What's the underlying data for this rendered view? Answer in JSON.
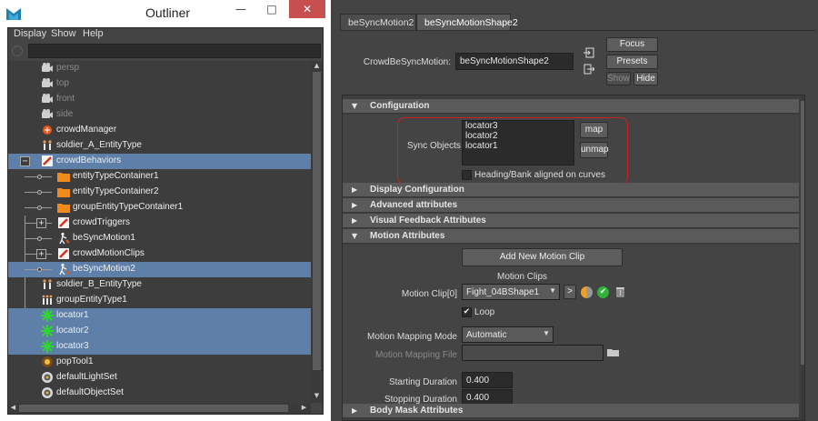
{
  "outliner": {
    "title": "Outliner",
    "window_buttons": {
      "minimize": "—",
      "maximize": "□",
      "close": "✕"
    },
    "menu": [
      "Display",
      "Show",
      "Help"
    ],
    "items": [
      {
        "label": "persp",
        "icon": "camera-icon",
        "dim": true,
        "selected": false
      },
      {
        "label": "top",
        "icon": "camera-icon",
        "dim": true,
        "selected": false
      },
      {
        "label": "front",
        "icon": "camera-icon",
        "dim": true,
        "selected": false
      },
      {
        "label": "side",
        "icon": "camera-icon",
        "dim": true,
        "selected": false
      },
      {
        "label": "crowdManager",
        "icon": "crowd-manager-icon",
        "dim": false,
        "selected": false
      },
      {
        "label": "soldier_A_EntityType",
        "icon": "entity-type-icon",
        "dim": false,
        "selected": false
      },
      {
        "label": "crowdBehaviors",
        "icon": "behavior-icon",
        "dim": false,
        "selected": true,
        "expander": "−"
      },
      {
        "label": "entityTypeContainer1",
        "icon": "folder-icon",
        "dim": false,
        "selected": false
      },
      {
        "label": "entityTypeContainer2",
        "icon": "folder-icon",
        "dim": false,
        "selected": false
      },
      {
        "label": "groupEntityTypeContainer1",
        "icon": "folder-icon",
        "dim": false,
        "selected": false
      },
      {
        "label": "crowdTriggers",
        "icon": "behavior-icon",
        "dim": false,
        "selected": false,
        "expander": "+"
      },
      {
        "label": "beSyncMotion1",
        "icon": "sync-motion-icon",
        "dim": false,
        "selected": false
      },
      {
        "label": "crowdMotionClips",
        "icon": "behavior-icon",
        "dim": false,
        "selected": false,
        "expander": "+"
      },
      {
        "label": "beSyncMotion2",
        "icon": "sync-motion-icon",
        "dim": false,
        "selected": true
      },
      {
        "label": "soldier_B_EntityType",
        "icon": "entity-type-icon",
        "dim": false,
        "selected": false
      },
      {
        "label": "groupEntityType1",
        "icon": "group-entity-icon",
        "dim": false,
        "selected": false
      },
      {
        "label": "locator1",
        "icon": "locator-icon",
        "dim": false,
        "selected": true
      },
      {
        "label": "locator2",
        "icon": "locator-icon",
        "dim": false,
        "selected": true
      },
      {
        "label": "locator3",
        "icon": "locator-icon",
        "dim": false,
        "selected": true
      },
      {
        "label": "popTool1",
        "icon": "pop-tool-icon",
        "dim": false,
        "selected": false
      },
      {
        "label": "defaultLightSet",
        "icon": "set-icon",
        "dim": false,
        "selected": false
      },
      {
        "label": "defaultObjectSet",
        "icon": "set-icon",
        "dim": false,
        "selected": false
      }
    ]
  },
  "attribute_editor": {
    "tabs": [
      "beSyncMotion2",
      "beSyncMotionShape2"
    ],
    "active_tab": 1,
    "node_label": "CrowdBeSyncMotion:",
    "node_name": "beSyncMotionShape2",
    "buttons": {
      "focus": "Focus",
      "presets": "Presets",
      "show": "Show",
      "hide": "Hide"
    },
    "configuration": {
      "title": "Configuration",
      "sync_objects_label": "Sync Objects",
      "sync_objects": [
        "locator3",
        "locator2",
        "locator1"
      ],
      "map": "map",
      "unmap": "unmap",
      "heading_label": "Heading/Bank aligned on curves",
      "heading_checked": false
    },
    "collapsed_sections": [
      "Display Configuration",
      "Advanced attributes",
      "Visual Feedback Attributes"
    ],
    "motion": {
      "title": "Motion Attributes",
      "add_clip": "Add New Motion Clip",
      "clips_header": "Motion Clips",
      "clip_label": "Motion Clip[0]",
      "clip_value": "Fight_04BShape1",
      "arrow": ">",
      "loop_label": "Loop",
      "loop_checked": true,
      "mapping_mode_label": "Motion Mapping Mode",
      "mapping_mode_value": "Automatic",
      "mapping_file_label": "Motion Mapping File",
      "mapping_file_value": "",
      "start_label": "Starting Duration",
      "start_value": "0.400",
      "stop_label": "Stopping Duration",
      "stop_value": "0.400"
    },
    "body_mask": {
      "title": "Body Mask Attributes"
    }
  },
  "colors": {
    "selection": "#5e7fa8",
    "highlight_box": "#cc2222",
    "panel_bg": "#444444"
  }
}
